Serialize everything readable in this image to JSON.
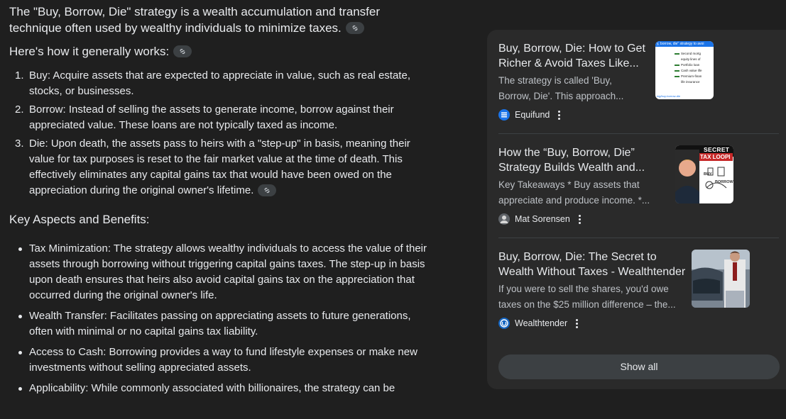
{
  "intro": {
    "line1": "The \"Buy, Borrow, Die\" strategy is a wealth accumulation and transfer",
    "line2": "technique often used by wealthy individuals to minimize taxes."
  },
  "how_heading": "Here's how it generally works:",
  "steps": [
    {
      "num": "1.",
      "lines": [
        "Buy: Acquire assets that are expected to appreciate in value, such as real estate,",
        "stocks, or businesses."
      ]
    },
    {
      "num": "2.",
      "lines": [
        "Borrow: Instead of selling the assets to generate income, borrow against their",
        "appreciated value. These loans are not typically taxed as income."
      ]
    },
    {
      "num": "3.",
      "lines": [
        "Die: Upon death, the assets pass to heirs with a \"step-up\" in basis, meaning their",
        "value for tax purposes is reset to the fair market value at the time of death. This",
        "effectively eliminates any capital gains tax that would have been owed on the",
        "appreciation during the original owner's lifetime."
      ]
    }
  ],
  "key_heading": "Key Aspects and Benefits:",
  "bullets": [
    {
      "lines": [
        "Tax Minimization: The strategy allows wealthy individuals to access the value of their",
        "assets through borrowing without triggering capital gains taxes. The step-up in basis",
        "upon death ensures that heirs also avoid capital gains tax on the appreciation that",
        "occurred during the original owner's life."
      ]
    },
    {
      "lines": [
        "Wealth Transfer: Facilitates passing on appreciating assets to future generations,",
        "often with minimal or no capital gains tax liability."
      ]
    },
    {
      "lines": [
        "Access to Cash: Borrowing provides a way to fund lifestyle expenses or make new",
        "investments without selling appreciated assets."
      ]
    },
    {
      "lines": [
        "Applicability: While commonly associated with billionaires, the strategy can be"
      ]
    }
  ],
  "sources": [
    {
      "title_lines": [
        "Buy, Borrow, Die: How to Get",
        "Richer & Avoid Taxes Like..."
      ],
      "snippet_lines": [
        "The strategy is called 'Buy,",
        "Borrow, Die'. This approach..."
      ],
      "source": "Equifund",
      "thumb_text": {
        "header": "y, borrow, die\" strategy to avoi",
        "items": [
          "Second mortg",
          "equity lines of",
          "Portfolio loan",
          "Cash value life",
          "Premium-finan",
          "life insurance"
        ],
        "footer": "ing/buy-borrow-die"
      }
    },
    {
      "title_lines": [
        "How the “Buy, Borrow, Die”",
        "Strategy Builds Wealth and..."
      ],
      "snippet_lines": [
        "Key Takeaways * Buy assets that",
        "appreciate and produce income. *..."
      ],
      "source": "Mat Sorensen",
      "thumb_text": {
        "line1": "SECRET R",
        "line2": "TAX LOOPI",
        "line3": "BORROW",
        "line4": "BUY"
      }
    },
    {
      "title_lines": [
        "Buy, Borrow, Die: The Secret to",
        "Wealth Without Taxes - Wealthtender"
      ],
      "snippet_lines": [
        "If you were to sell the shares, you'd owe",
        "taxes on the $25 million difference – the..."
      ],
      "source": "Wealthtender"
    }
  ],
  "show_all": "Show all"
}
